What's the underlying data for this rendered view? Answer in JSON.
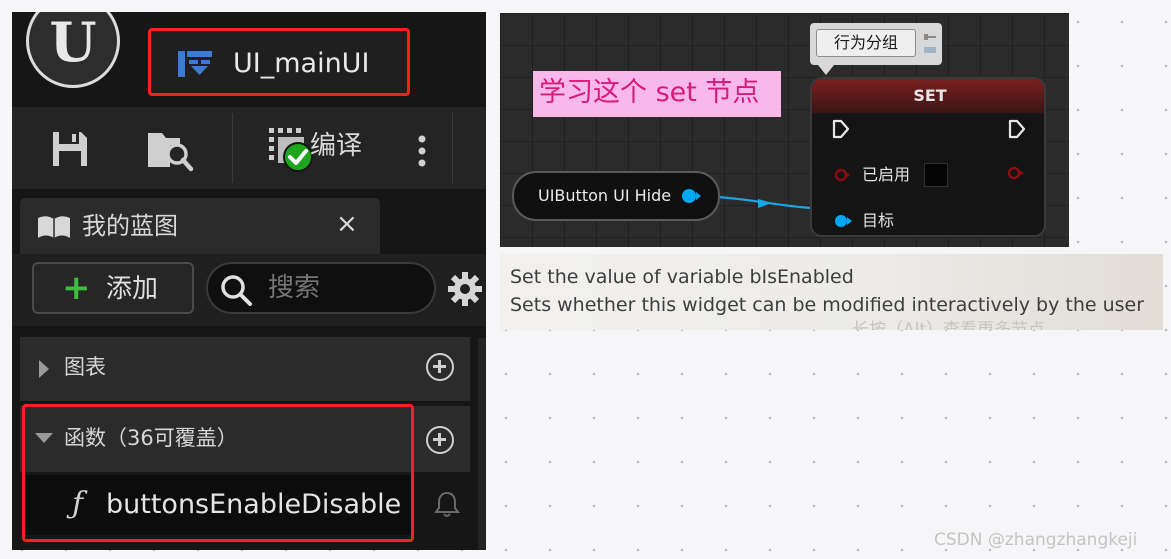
{
  "editor": {
    "tab_title": "UI_mainUI",
    "compile_label": "编译",
    "my_blueprint": {
      "title": "我的蓝图",
      "close": "×"
    },
    "add_button": {
      "plus": "+",
      "label": "添加"
    },
    "search": {
      "placeholder": "搜索"
    },
    "sections": {
      "graphs": {
        "label": "图表"
      },
      "functions": {
        "label": "函数（36可覆盖）"
      }
    },
    "function_item": {
      "glyph": "ƒ",
      "name": "buttonsEnableDisable"
    },
    "icons": [
      "unreal-logo-icon",
      "blueprint-icon",
      "save-icon",
      "browse-icon",
      "compile-status-icon",
      "more-options-icon",
      "book-icon",
      "search-icon",
      "gear-icon",
      "plus-circle-icon",
      "function-icon",
      "bell-icon"
    ],
    "colors": {
      "highlight_border": "#ff1e1e",
      "add_plus": "#3fbd3f",
      "compile_ok": "#1ea51e"
    }
  },
  "graph": {
    "note_text": "学习这个 set 节点",
    "comment_label": "行为分组",
    "set_node": {
      "title": "SET",
      "enabled_label": "已启用",
      "target_label": "目标"
    },
    "getter_node": {
      "label": "UIButton UI Hide"
    },
    "colors": {
      "note_bg": "#f8b8ea",
      "note_text": "#d81b7a",
      "object_pin": "#00a8f3",
      "bool_pin": "#8b0d0d"
    }
  },
  "tooltip": {
    "line1": "Set the value of variable bIsEnabled",
    "line2": "Sets whether this widget can be modified interactively by the user",
    "ghost_text": "长按（Alt）查看更多节点..."
  },
  "watermark": "CSDN @zhangzhangkeji"
}
